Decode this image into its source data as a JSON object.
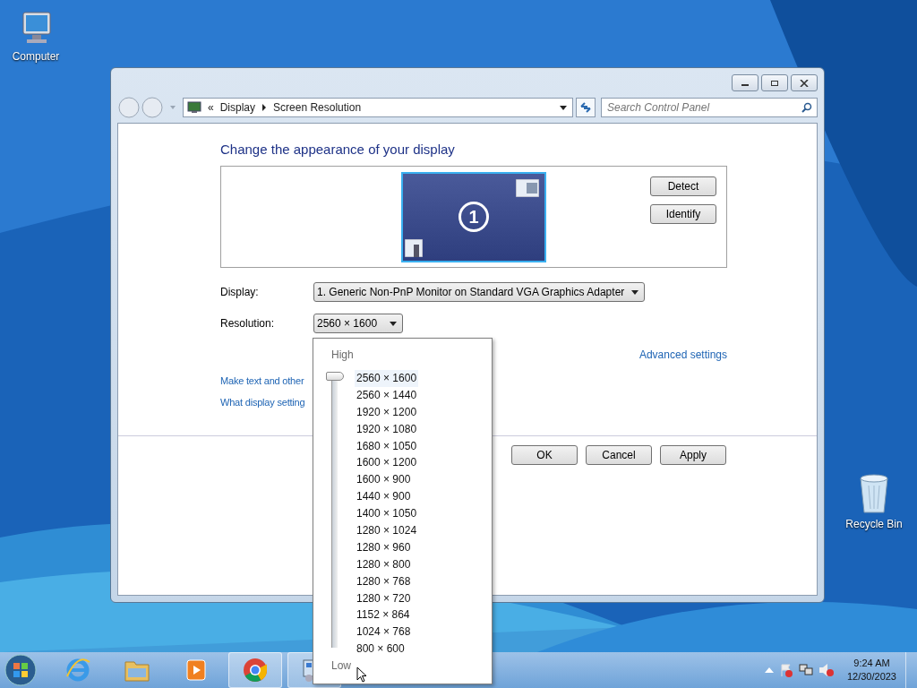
{
  "desktop_icons": [
    {
      "label": "Computer",
      "kind": "computer"
    },
    {
      "label": "Recycle Bin",
      "kind": "bin"
    }
  ],
  "window": {
    "overflow_chevron": "«",
    "breadcrumb": [
      "Display",
      "Screen Resolution"
    ],
    "search": {
      "placeholder": "Search Control Panel"
    }
  },
  "heading": "Change the appearance of your display",
  "monitor": {
    "number": "1",
    "selected": true
  },
  "side_buttons": [
    "Detect",
    "Identify"
  ],
  "display": {
    "label": "Display:",
    "value": "1. Generic Non-PnP Monitor on Standard VGA Graphics Adapter"
  },
  "resolution": {
    "label": "Resolution:",
    "value": "2560 × 1600"
  },
  "advanced_link": "Advanced settings",
  "links": [
    "Make text and other",
    "What display setting"
  ],
  "buttons": [
    "OK",
    "Cancel",
    "Apply"
  ],
  "resolution_popup": {
    "high_label": "High",
    "low_label": "Low",
    "level": 1,
    "options": [
      {
        "label": "2560 × 1600",
        "selected": true
      },
      {
        "label": "2560 × 1440",
        "selected": false
      },
      {
        "label": "1920 × 1200",
        "selected": false
      },
      {
        "label": "1920 × 1080",
        "selected": false
      },
      {
        "label": "1680 × 1050",
        "selected": false
      },
      {
        "label": "1600 × 1200",
        "selected": false
      },
      {
        "label": "1600 × 900",
        "selected": false
      },
      {
        "label": "1440 × 900",
        "selected": false
      },
      {
        "label": "1400 × 1050",
        "selected": false
      },
      {
        "label": "1280 × 1024",
        "selected": false
      },
      {
        "label": "1280 × 960",
        "selected": false
      },
      {
        "label": "1280 × 800",
        "selected": false
      },
      {
        "label": "1280 × 768",
        "selected": false
      },
      {
        "label": "1280 × 720",
        "selected": false
      },
      {
        "label": "1152 × 864",
        "selected": false
      },
      {
        "label": "1024 × 768",
        "selected": false
      },
      {
        "label": "800 × 600",
        "selected": false
      }
    ]
  },
  "taskbar": {
    "apps": [
      {
        "kind": "ie",
        "active": false
      },
      {
        "kind": "folder",
        "active": false
      },
      {
        "kind": "media",
        "active": false
      },
      {
        "kind": "chrome",
        "active": true
      },
      {
        "kind": "control",
        "active": true
      }
    ],
    "clock": {
      "time": "9:24 AM",
      "date": "12/30/2023"
    }
  }
}
